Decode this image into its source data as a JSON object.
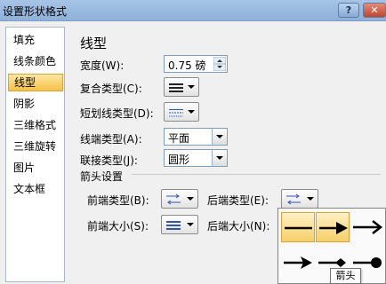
{
  "window": {
    "title": "设置形状格式",
    "help_glyph": "?",
    "close_glyph": "✕"
  },
  "nav": {
    "items": [
      {
        "label": "填充"
      },
      {
        "label": "线条颜色"
      },
      {
        "label": "线型"
      },
      {
        "label": "阴影"
      },
      {
        "label": "三维格式"
      },
      {
        "label": "三维旋转"
      },
      {
        "label": "图片"
      },
      {
        "label": "文本框"
      }
    ],
    "selected_index": 2
  },
  "panel": {
    "title": "线型",
    "width": {
      "label": "宽度(W):",
      "value": "0.75 磅"
    },
    "compound": {
      "label": "复合类型(C):"
    },
    "dash": {
      "label": "短划线类型(D):"
    },
    "cap": {
      "label": "线端类型(A):",
      "value": "平面"
    },
    "join": {
      "label": "联接类型(J):",
      "value": "圆形"
    },
    "arrows": {
      "section_label": "箭头设置",
      "begin_type_label": "前端类型(B):",
      "end_type_label": "后端类型(E):",
      "begin_size_label": "前端大小(S):",
      "end_size_label": "后端大小(N):"
    }
  },
  "tooltip": "箭头",
  "colors": {
    "selection_fill": "#f6c148",
    "titlebar": "#a7c4e6",
    "close": "#c0452f"
  }
}
